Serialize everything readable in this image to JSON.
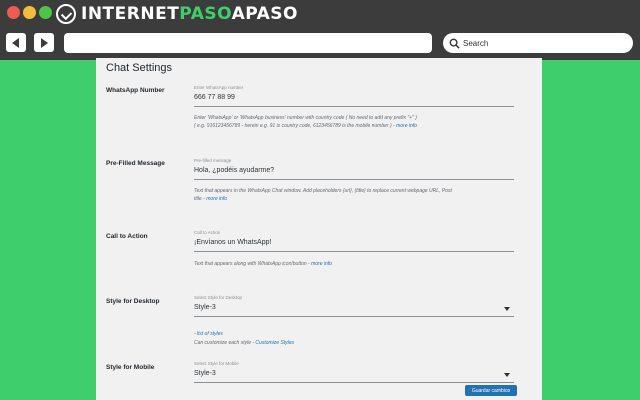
{
  "brand": {
    "logo_pre": "INTERNET",
    "logo_accent": "PASO",
    "logo_post": "APASO"
  },
  "nav": {
    "back_icon": "arrow-left-icon",
    "forward_icon": "arrow-right-icon"
  },
  "search": {
    "label": "Search"
  },
  "panel": {
    "title": "Chat Settings"
  },
  "rows": {
    "number": {
      "label": "WhatsApp Number",
      "caption": "Enter WhatsApp number",
      "value": "666 77 88 99",
      "desc1": "Enter 'WhatsApp' or 'WhatsApp business' number with country code ( No need to add any prefix \"+\" )",
      "desc2": "( e.g. 916123456789 - herein e.g. 91 is country code, 6123456789 is the mobile number ) -",
      "link": "more info"
    },
    "prefilled": {
      "label": "Pre-Filled Message",
      "caption": "Pre-filled message",
      "value": "Hola, ¿podéis ayudarme?",
      "desc1": "Text that appears in the WhatsApp Chat window. Add placeholders {url}, {title} to replace current webpage URL, Post",
      "desc2": "title -",
      "link": "more info"
    },
    "cta": {
      "label": "Call to Action",
      "caption": "Call to Action",
      "value": "¡Envíanos un WhatsApp!",
      "desc1": "Text that appears along with WhatsApp icon/button -",
      "link": "more info"
    },
    "desktop": {
      "label": "Style for Desktop",
      "caption": "Select Style for Desktop",
      "value": "Style-3",
      "link1": "- list of styles",
      "desc2": "Can customize each style -",
      "link2": "Customize Styles"
    },
    "mobile": {
      "label": "Style for Mobile",
      "caption": "Select Style for Mobile",
      "value": "Style-3"
    }
  },
  "save_button": "Guardar cambios",
  "colors": {
    "background": "#3ecf6c",
    "chrome": "#3c3c3c",
    "link": "#2271b1",
    "button": "#2271b1"
  }
}
